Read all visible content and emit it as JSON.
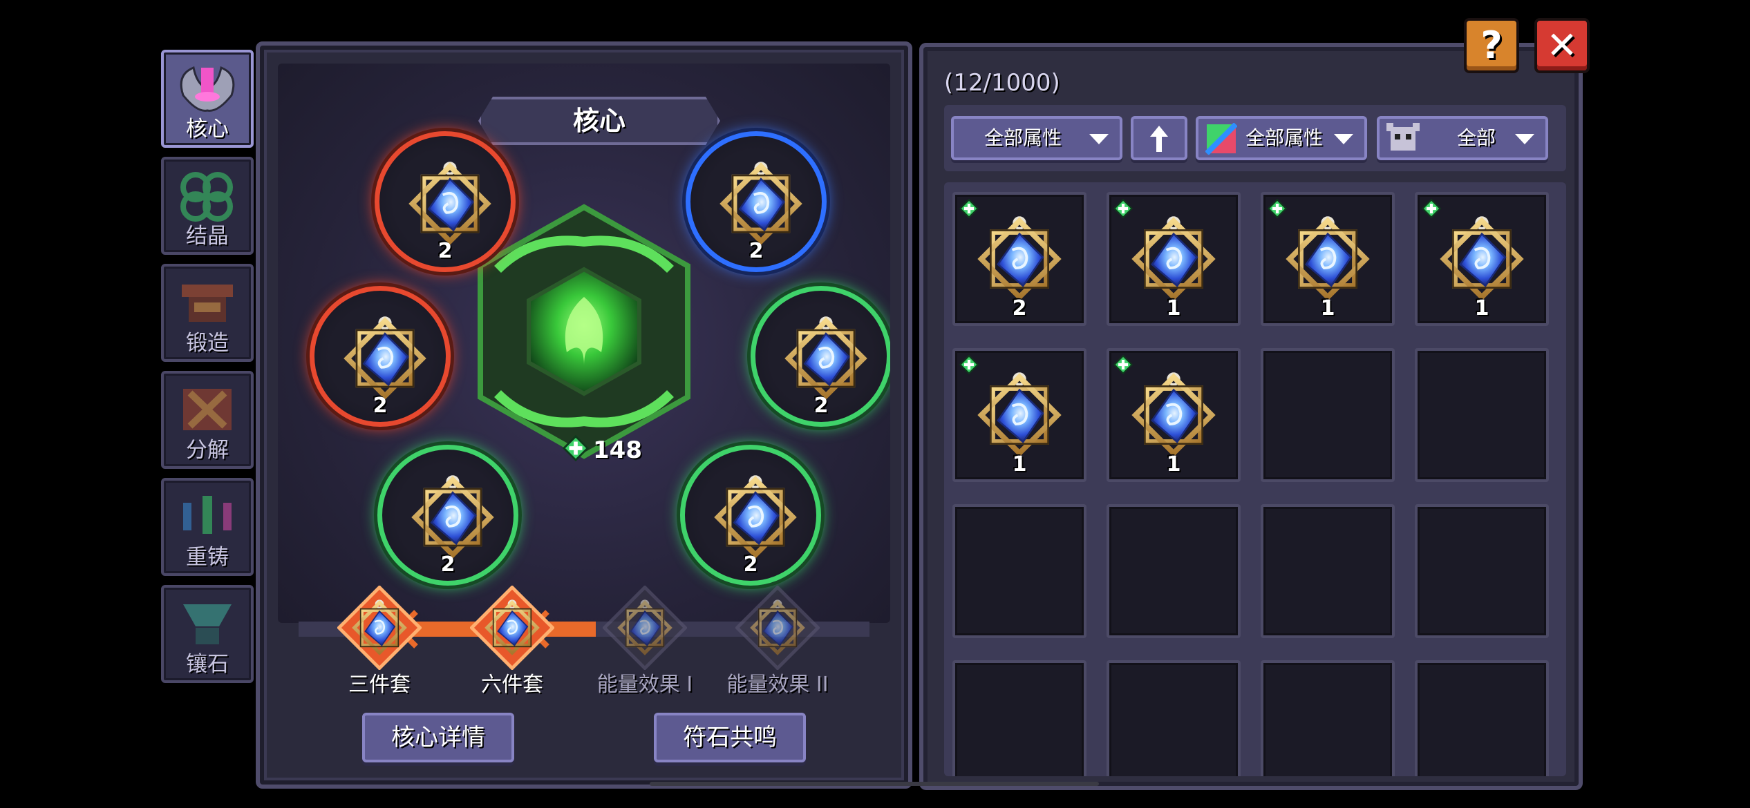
{
  "side_tabs": [
    {
      "label": "核心",
      "active": true,
      "icon": "core-icon"
    },
    {
      "label": "结晶",
      "active": false,
      "icon": "crystal-icon"
    },
    {
      "label": "锻造",
      "active": false,
      "icon": "forge-icon"
    },
    {
      "label": "分解",
      "active": false,
      "icon": "decompose-icon"
    },
    {
      "label": "重铸",
      "active": false,
      "icon": "recast-icon"
    },
    {
      "label": "镶石",
      "active": false,
      "icon": "inlay-icon"
    }
  ],
  "core": {
    "title": "核心",
    "energy_value": "148",
    "slots": [
      {
        "count": "2",
        "ring": "red"
      },
      {
        "count": "2",
        "ring": "blue"
      },
      {
        "count": "2",
        "ring": "red"
      },
      {
        "count": "2",
        "ring": "green"
      },
      {
        "count": "2",
        "ring": "green"
      },
      {
        "count": "2",
        "ring": "green"
      }
    ],
    "set_bonuses": [
      {
        "label": "三件套",
        "active": true
      },
      {
        "label": "六件套",
        "active": true
      },
      {
        "label": "能量效果 I",
        "active": false
      },
      {
        "label": "能量效果 II",
        "active": false
      }
    ],
    "details_button": "核心详情",
    "resonance_button": "符石共鸣"
  },
  "inventory": {
    "count_text": "(12/1000)",
    "filters": {
      "attribute_1": "全部属性",
      "attribute_2": "全部属性",
      "type": "全部"
    },
    "items": [
      {
        "qty": "2",
        "new": true
      },
      {
        "qty": "1",
        "new": true
      },
      {
        "qty": "1",
        "new": true
      },
      {
        "qty": "1",
        "new": true
      },
      {
        "qty": "1",
        "new": true
      },
      {
        "qty": "1",
        "new": true
      }
    ]
  },
  "buttons": {
    "help": "?",
    "close": "✕"
  },
  "colors": {
    "ring_red": "#e8492f",
    "ring_blue": "#2e6fff",
    "ring_green": "#3fd36a",
    "button_purple": "#5d5a91",
    "help_orange": "#d8842c",
    "close_red": "#d63a32"
  }
}
